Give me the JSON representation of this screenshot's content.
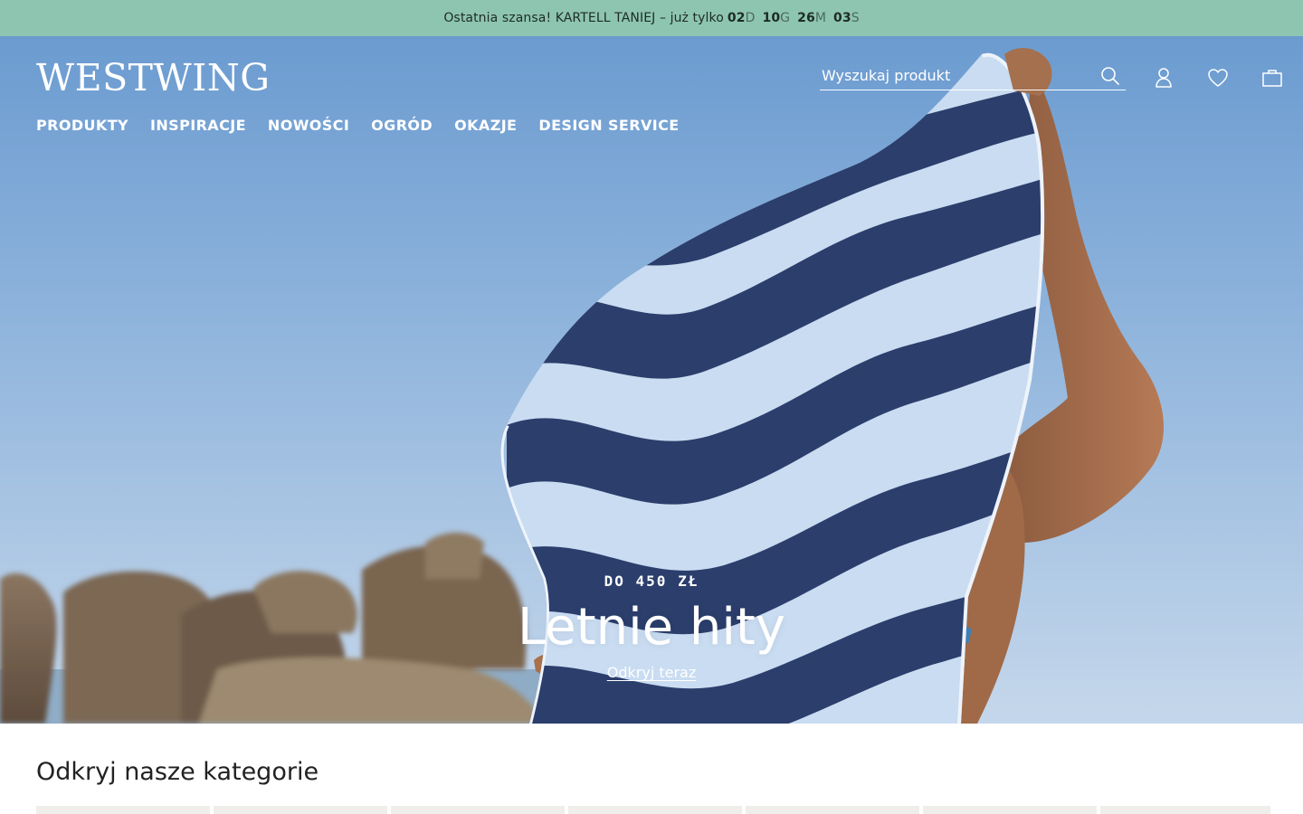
{
  "promo": {
    "text": "Ostatnia szansa! KARTELL TANIEJ – już tylko",
    "countdown": [
      {
        "value": "02",
        "unit": "D"
      },
      {
        "value": "10",
        "unit": "G"
      },
      {
        "value": "26",
        "unit": "M"
      },
      {
        "value": "03",
        "unit": "S"
      }
    ]
  },
  "header": {
    "logo": "WESTWING",
    "nav": [
      "PRODUKTY",
      "INSPIRACJE",
      "NOWOŚCI",
      "OGRÓD",
      "OKAZJE",
      "DESIGN SERVICE"
    ],
    "search_placeholder": "Wyszukaj produkt",
    "icons": [
      "search-icon",
      "user-icon",
      "heart-icon",
      "bag-icon"
    ]
  },
  "hero": {
    "eyebrow": "DO 450 ZŁ",
    "title": "Letnie hity",
    "cta": "Odkryj teraz"
  },
  "categories": {
    "title": "Odkryj nasze kategorie"
  },
  "colors": {
    "promo_bg": "#8ec5b0",
    "sky": "#86afd9",
    "towel_navy": "#2a3f6e",
    "towel_light": "#c7daf0"
  }
}
